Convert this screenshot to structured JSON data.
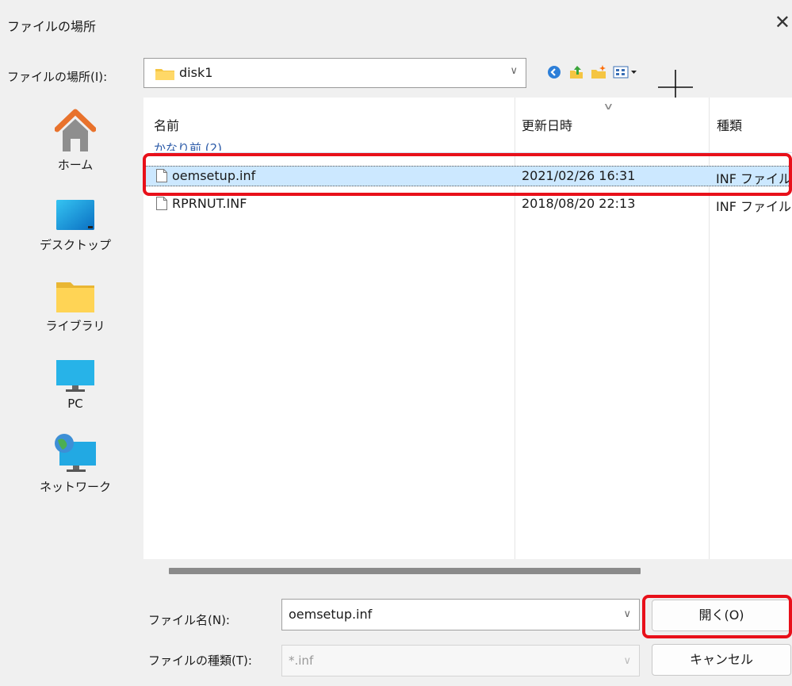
{
  "window": {
    "title": "ファイルの場所",
    "close_glyph": "✕"
  },
  "location": {
    "label": "ファイルの場所(I):",
    "value": "disk1"
  },
  "toolbar": [
    "back-icon",
    "up-folder-icon",
    "new-folder-icon",
    "view-menu-icon"
  ],
  "places": [
    {
      "label": "ホーム",
      "icon": "home-icon"
    },
    {
      "label": "デスクトップ",
      "icon": "desktop-icon"
    },
    {
      "label": "ライブラリ",
      "icon": "library-icon"
    },
    {
      "label": "PC",
      "icon": "pc-icon"
    },
    {
      "label": "ネットワーク",
      "icon": "network-icon"
    }
  ],
  "list": {
    "columns": [
      "名前",
      "更新日時",
      "種類"
    ],
    "group": "かなり前 (2)",
    "rows": [
      {
        "name": "oemsetup.inf",
        "date": "2021/02/26 16:31",
        "type": "INF ファイル",
        "selected": true
      },
      {
        "name": "RPRNUT.INF",
        "date": "2018/08/20 22:13",
        "type": "INF ファイル",
        "selected": false
      }
    ]
  },
  "filename": {
    "label": "ファイル名(N):",
    "value": "oemsetup.inf"
  },
  "filetype": {
    "label": "ファイルの種類(T):",
    "value": "*.inf"
  },
  "buttons": {
    "open": "開く(O)",
    "cancel": "キャンセル"
  },
  "colors": {
    "highlight": "#e8101a",
    "selection": "#cce8ff",
    "folder": "#f5c542"
  }
}
